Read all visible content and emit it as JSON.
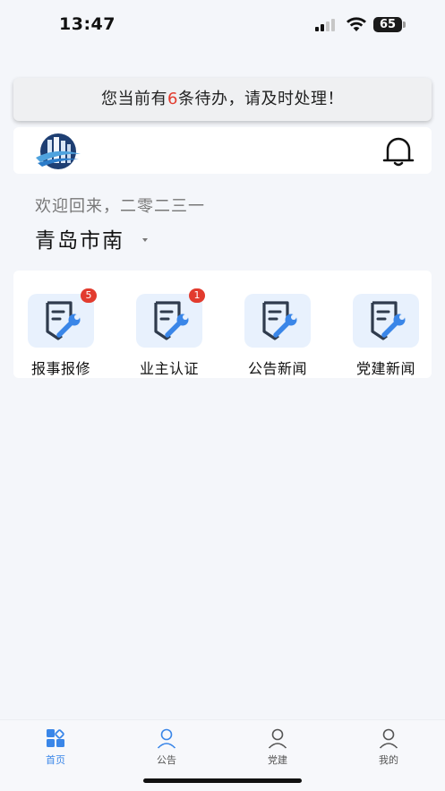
{
  "status_bar": {
    "time": "13:47",
    "battery_level": "65",
    "icons": [
      "cellular-signal-icon",
      "wifi-icon",
      "battery-icon"
    ]
  },
  "todo_banner": {
    "prefix": "您当前有",
    "count": "6",
    "suffix": "条待办，请及时处理！",
    "count_color": "#e23b2e"
  },
  "header": {
    "logo_icon": "building-logo-icon",
    "bell_icon": "bell-icon"
  },
  "welcome": {
    "greeting": "欢迎回来，二零二三一",
    "community": "青岛市南"
  },
  "menu": {
    "items": [
      {
        "label": "报事报修",
        "badge": "5",
        "icon": "repair-document-icon"
      },
      {
        "label": "业主认证",
        "badge": "1",
        "icon": "repair-document-icon"
      },
      {
        "label": "公告新闻",
        "badge": "",
        "icon": "repair-document-icon"
      },
      {
        "label": "党建新闻",
        "badge": "",
        "icon": "repair-document-icon"
      }
    ]
  },
  "tab_bar": {
    "tabs": [
      {
        "label": "首页",
        "icon": "home-grid-icon",
        "active": true
      },
      {
        "label": "公告",
        "icon": "person-icon",
        "active": false
      },
      {
        "label": "党建",
        "icon": "person-icon",
        "active": false
      },
      {
        "label": "我的",
        "icon": "person-icon",
        "active": false
      }
    ]
  },
  "colors": {
    "accent": "#3a86e8",
    "icon_dark": "#2f3b4d",
    "badge": "#e23b2e",
    "background": "#f4f6fa"
  }
}
